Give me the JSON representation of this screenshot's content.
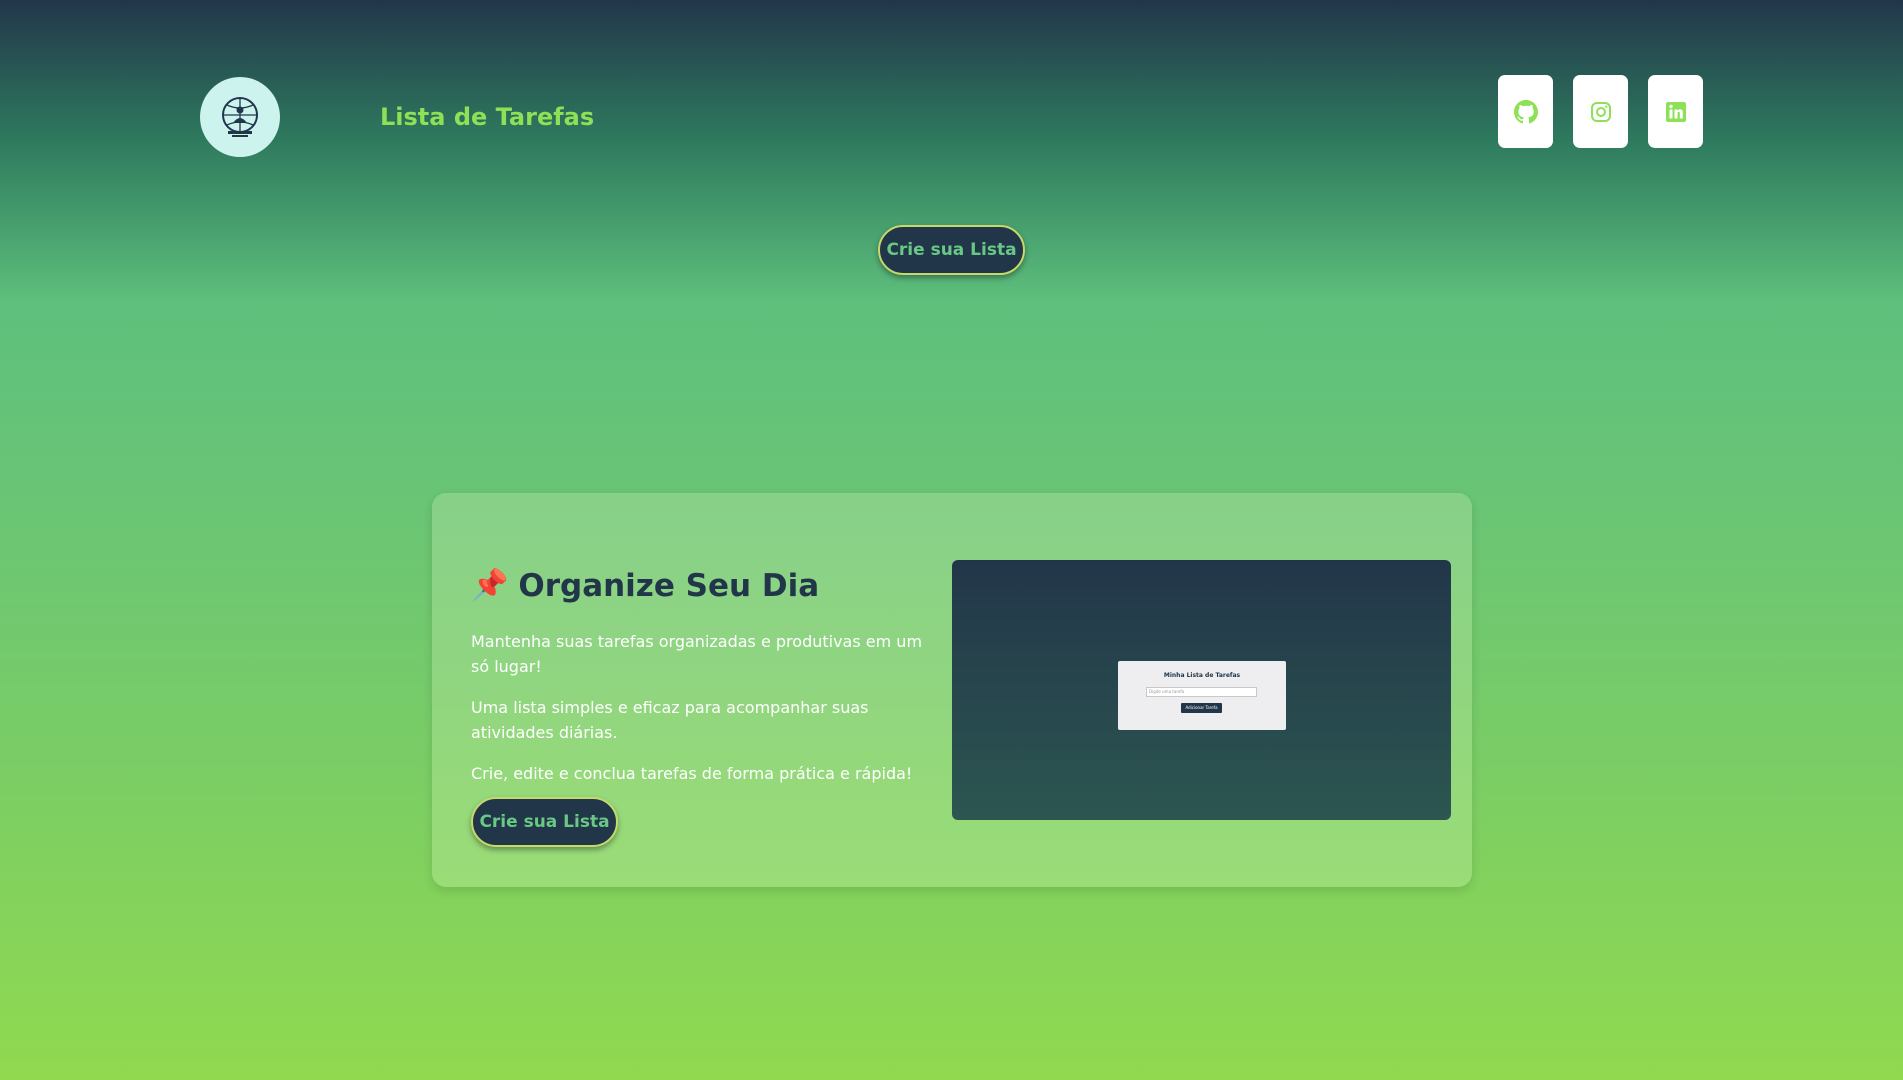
{
  "header": {
    "title": "Lista de Tarefas",
    "logo_icon": "globe-person-logo-icon",
    "social": [
      {
        "name": "github",
        "icon": "github-icon"
      },
      {
        "name": "instagram",
        "icon": "instagram-icon"
      },
      {
        "name": "linkedin",
        "icon": "linkedin-icon"
      }
    ]
  },
  "hero": {
    "cta_label": "Crie sua Lista"
  },
  "card": {
    "emoji": "📌",
    "heading": "Organize Seu Dia",
    "paragraphs": [
      "Mantenha suas tarefas organizadas e produtivas em um só lugar!",
      "Uma lista simples e eficaz para acompanhar suas atividades diárias.",
      "Crie, edite e conclua tarefas de forma prática e rápida!"
    ],
    "cta_label": "Crie sua Lista",
    "preview": {
      "title": "Minha Lista de Tarefas",
      "input_placeholder": "Digite uma tarefa",
      "button_label": "Adicionar Tarefa"
    }
  },
  "colors": {
    "dark": "#22364a",
    "accent_green": "#8ee057",
    "button_text": "#68c884",
    "button_border": "#c7d96a"
  }
}
